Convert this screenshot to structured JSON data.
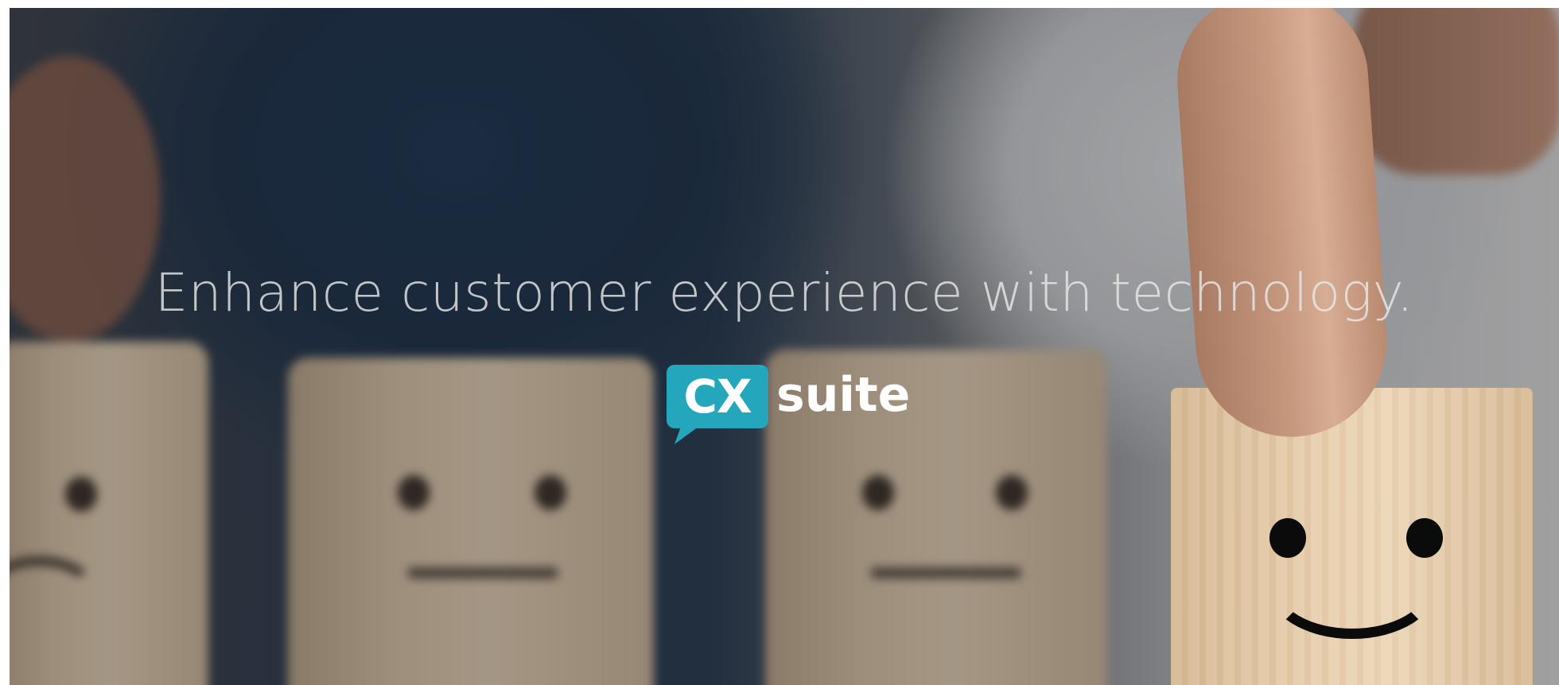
{
  "hero": {
    "headline": "Enhance customer experience with technology.",
    "background_image": "Wooden blocks with emoji faces ranging from sad to happy, a finger touching the smiling block"
  },
  "logo": {
    "badge_text": "CX",
    "word_text": "suite",
    "colors": {
      "badge": "#24a6bd",
      "text": "#ffffff"
    }
  }
}
